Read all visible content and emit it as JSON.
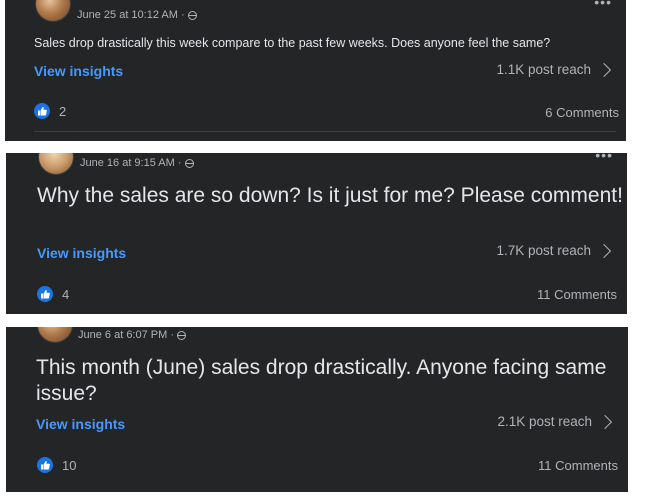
{
  "posts": [
    {
      "timestamp": "June 25 at 10:12 AM ·",
      "text": "Sales drop drastically this week compare to the past few weeks. Does anyone feel the same?",
      "insights_label": "View insights",
      "reach": "1.1K post reach",
      "likes": "2",
      "comments": "6 Comments"
    },
    {
      "timestamp": "June 16 at 9:15 AM ·",
      "text": "Why the sales are so down? Is it just for me? Please comment!",
      "insights_label": "View insights",
      "reach": "1.7K post reach",
      "likes": "4",
      "comments": "11 Comments"
    },
    {
      "timestamp": "June 6 at 6:07 PM ·",
      "text": "This month (June) sales drop drastically. Anyone facing same issue?",
      "insights_label": "View insights",
      "reach": "2.1K post reach",
      "likes": "10",
      "comments": "11 Comments"
    }
  ],
  "icons": {
    "like": "thumbs-up-icon",
    "audience": "globe-icon",
    "more": "more-options-icon",
    "chevron": "chevron-right-icon"
  },
  "colors": {
    "card_background": "#242526",
    "link": "#4599ff",
    "like_badge": "#1b74e4",
    "secondary_text": "#b0b3b8",
    "primary_text": "#e4e6eb"
  }
}
